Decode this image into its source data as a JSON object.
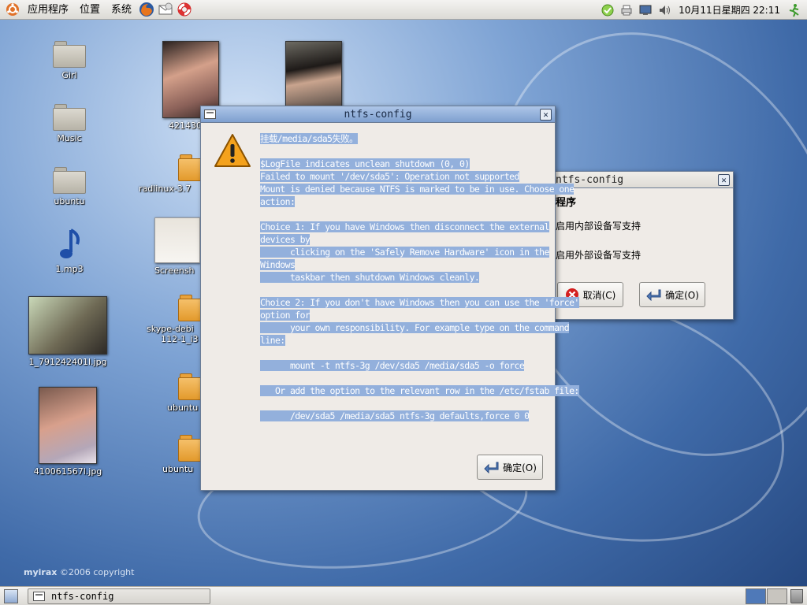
{
  "panel": {
    "menus": [
      "应用程序",
      "位置",
      "系统"
    ],
    "launchers": [
      "firefox-icon",
      "evolution-mail-icon",
      "help-lifebuoy-icon"
    ],
    "tray": [
      "network-icon",
      "printer-icon",
      "display-icon",
      "volume-icon"
    ],
    "clock": "10月11日星期四 22:11"
  },
  "desktop": {
    "icons": {
      "girl": "Girl",
      "music": "Music",
      "ubuntu": "ubuntu",
      "mp3": "1.mp3",
      "photo1": "42143071",
      "photo3": "1_791242401l.jpg",
      "photo4": "410061567l.jpg",
      "radlinux": "radlinux-3.7",
      "screenshot": "Screensh",
      "skype": "skype-debi",
      "skype2": "112-1_i3",
      "ubuntu2": "ubuntu",
      "ubuntu3": "ubuntu"
    },
    "copyright_brand": "myirax",
    "copyright_rest": " ©2006 copyright"
  },
  "back_window": {
    "title": "ntfs-config",
    "heading": "程序",
    "opt1": "启用内部设备写支持",
    "opt2": "启用外部设备写支持",
    "cancel": "取消(C)",
    "ok": "确定(O)"
  },
  "dialog": {
    "title": "ntfs-config",
    "lines": [
      "挂载/media/sda5失败。",
      "",
      "$LogFile indicates unclean shutdown (0, 0)",
      "Failed to mount '/dev/sda5': Operation not supported",
      "Mount is denied because NTFS is marked to be in use. Choose one",
      "action:",
      "",
      "Choice 1: If you have Windows then disconnect the external",
      "devices by",
      "      clicking on the 'Safely Remove Hardware' icon in the",
      "Windows",
      "      taskbar then shutdown Windows cleanly.",
      "",
      "Choice 2: If you don't have Windows then you can use the 'force'",
      "option for",
      "      your own responsibility. For example type on the command",
      "line:",
      "",
      "      mount -t ntfs-3g /dev/sda5 /media/sda5 -o force",
      "",
      "   Or add the option to the relevant row in the /etc/fstab file:",
      "",
      "      /dev/sda5 /media/sda5 ntfs-3g defaults,force 0 0"
    ],
    "ok": "确定(O)"
  },
  "taskbar": {
    "task": "ntfs-config"
  }
}
